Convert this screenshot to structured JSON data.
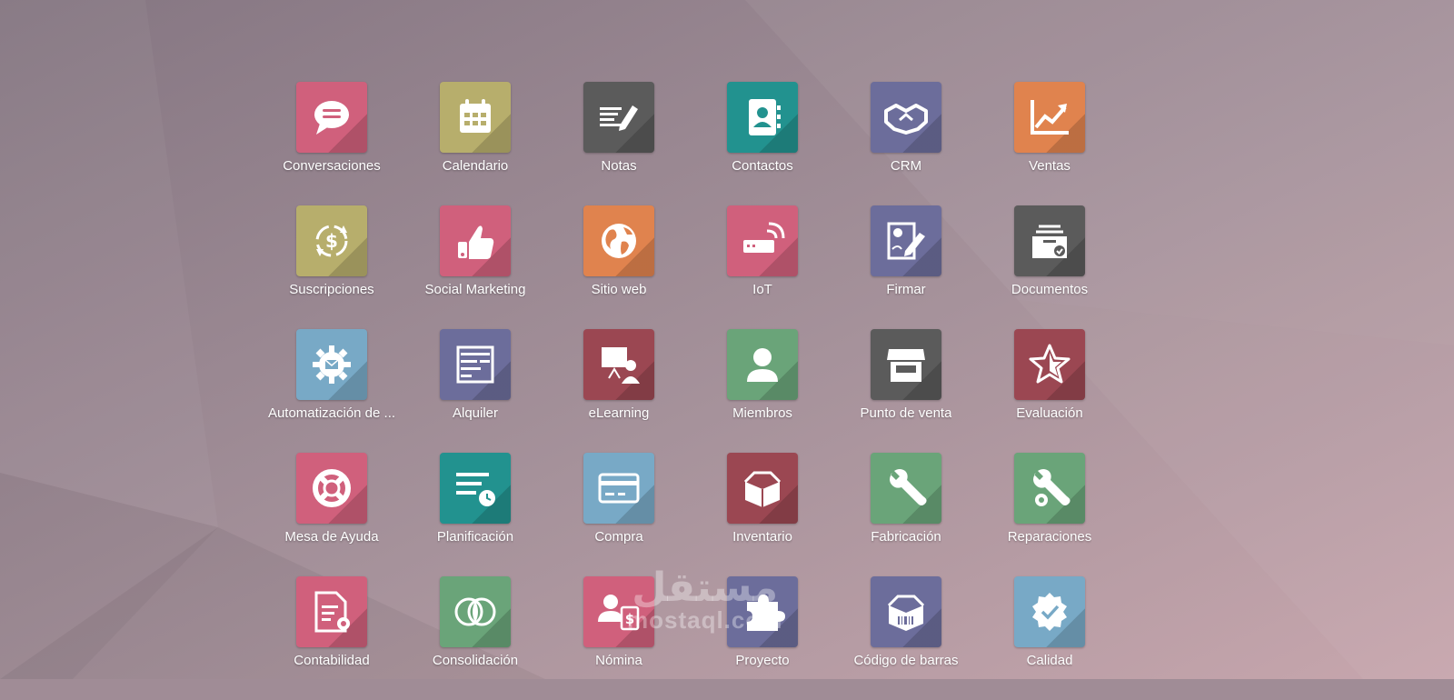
{
  "colors": {
    "background": "#a08c96",
    "pink": "#d0607c",
    "olive": "#b7ae6c",
    "gray": "#5b5b5b",
    "teal": "#22928f",
    "slate": "#6c6d9b",
    "orange": "#e0834e",
    "blue": "#78a9c6",
    "maroon": "#9b4752",
    "green": "#6aa479"
  },
  "apps": [
    {
      "label": "Conversaciones",
      "icon": "chat-bubble-icon",
      "color": "#d0607c"
    },
    {
      "label": "Calendario",
      "icon": "calendar-icon",
      "color": "#b7ae6c"
    },
    {
      "label": "Notas",
      "icon": "notes-pencil-icon",
      "color": "#5b5b5b"
    },
    {
      "label": "Contactos",
      "icon": "contact-book-icon",
      "color": "#22928f"
    },
    {
      "label": "CRM",
      "icon": "handshake-icon",
      "color": "#6c6d9b"
    },
    {
      "label": "Ventas",
      "icon": "trend-chart-icon",
      "color": "#e0834e"
    },
    {
      "label": "Suscripciones",
      "icon": "recurring-dollar-icon",
      "color": "#b7ae6c"
    },
    {
      "label": "Social Marketing",
      "icon": "thumbs-up-icon",
      "color": "#d0607c"
    },
    {
      "label": "Sitio web",
      "icon": "globe-icon",
      "color": "#e0834e"
    },
    {
      "label": "IoT",
      "icon": "iot-device-icon",
      "color": "#d0607c"
    },
    {
      "label": "Firmar",
      "icon": "sign-document-icon",
      "color": "#6c6d9b"
    },
    {
      "label": "Documentos",
      "icon": "document-tray-icon",
      "color": "#5b5b5b"
    },
    {
      "label": "Automatización de ...",
      "icon": "gear-mail-icon",
      "color": "#78a9c6"
    },
    {
      "label": "Alquiler",
      "icon": "rental-grid-icon",
      "color": "#6c6d9b"
    },
    {
      "label": "eLearning",
      "icon": "presentation-icon",
      "color": "#9b4752"
    },
    {
      "label": "Miembros",
      "icon": "member-user-icon",
      "color": "#6aa479"
    },
    {
      "label": "Punto de venta",
      "icon": "shop-icon",
      "color": "#5b5b5b"
    },
    {
      "label": "Evaluación",
      "icon": "star-icon",
      "color": "#9b4752"
    },
    {
      "label": "Mesa de Ayuda",
      "icon": "lifebuoy-icon",
      "color": "#d0607c"
    },
    {
      "label": "Planificación",
      "icon": "planning-clock-icon",
      "color": "#22928f"
    },
    {
      "label": "Compra",
      "icon": "credit-card-icon",
      "color": "#78a9c6"
    },
    {
      "label": "Inventario",
      "icon": "open-box-icon",
      "color": "#9b4752"
    },
    {
      "label": "Fabricación",
      "icon": "wrench-icon",
      "color": "#6aa479"
    },
    {
      "label": "Reparaciones",
      "icon": "wrench-gear-icon",
      "color": "#6aa479"
    },
    {
      "label": "Contabilidad",
      "icon": "invoice-gear-icon",
      "color": "#d0607c"
    },
    {
      "label": "Consolidación",
      "icon": "overlap-circles-icon",
      "color": "#6aa479"
    },
    {
      "label": "Nómina",
      "icon": "payroll-user-icon",
      "color": "#d0607c"
    },
    {
      "label": "Proyecto",
      "icon": "puzzle-icon",
      "color": "#6c6d9b"
    },
    {
      "label": "Código de barras",
      "icon": "barcode-box-icon",
      "color": "#6c6d9b"
    },
    {
      "label": "Calidad",
      "icon": "quality-badge-icon",
      "color": "#78a9c6"
    }
  ],
  "watermark": {
    "line1": "مستقل",
    "line2": "mostaql.com"
  }
}
